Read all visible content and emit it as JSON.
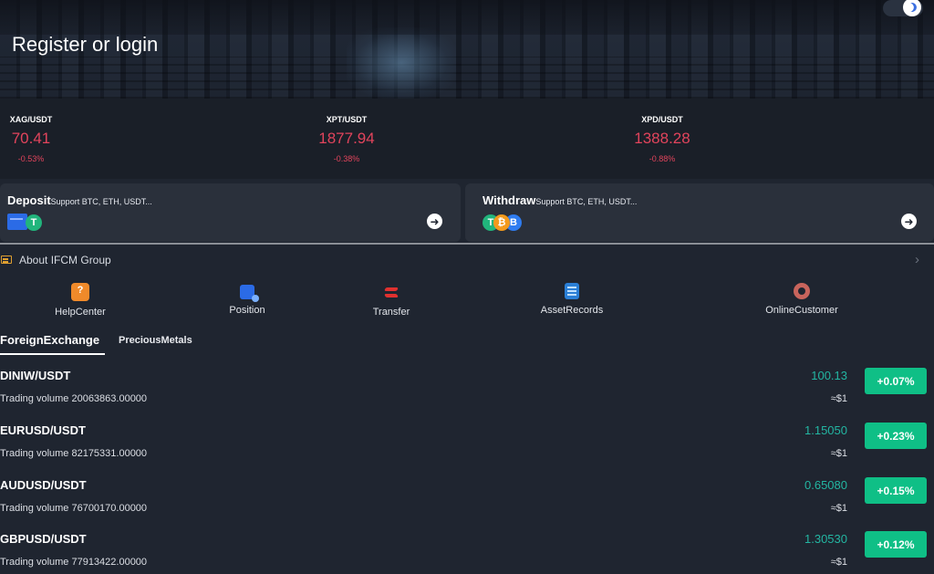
{
  "header": {
    "title": "Register or login",
    "theme_toggle_icon": "moon-icon"
  },
  "tickers": [
    {
      "symbol": "XAG/USDT",
      "price": "70.41",
      "change": "-0.53%"
    },
    {
      "symbol": "XPT/USDT",
      "price": "1877.94",
      "change": "-0.38%"
    },
    {
      "symbol": "XPD/USDT",
      "price": "1388.28",
      "change": "-0.88%"
    }
  ],
  "deposit": {
    "title": "Deposit",
    "subtitle": "Support BTC, ETH, USDT...",
    "arrow": "➜"
  },
  "withdraw": {
    "title": "Withdraw",
    "subtitle": "Support BTC, ETH, USDT...",
    "arrow": "➜"
  },
  "coins": {
    "tether": "T",
    "bitcoin": "₿",
    "ether": "B"
  },
  "about": {
    "label": "About IFCM Group",
    "chevron": "›"
  },
  "menu": [
    {
      "label": "HelpCenter",
      "icon": "help-icon"
    },
    {
      "label": "Position",
      "icon": "position-icon"
    },
    {
      "label": "Transfer",
      "icon": "transfer-icon"
    },
    {
      "label": "AssetRecords",
      "icon": "asset-records-icon"
    },
    {
      "label": "OnlineCustomer",
      "icon": "customer-service-icon"
    }
  ],
  "tabs": {
    "active": "ForeignExchange",
    "inactive": "PreciousMetals"
  },
  "markets": [
    {
      "pair": "DINIW/USDT",
      "volume": "Trading volume 20063863.00000",
      "price": "100.13",
      "usd": "≈$1",
      "change": "+0.07%"
    },
    {
      "pair": "EURUSD/USDT",
      "volume": "Trading volume 82175331.00000",
      "price": "1.15050",
      "usd": "≈$1",
      "change": "+0.23%"
    },
    {
      "pair": "AUDUSD/USDT",
      "volume": "Trading volume 76700170.00000",
      "price": "0.65080",
      "usd": "≈$1",
      "change": "+0.15%"
    },
    {
      "pair": "GBPUSD/USDT",
      "volume": "Trading volume 77913422.00000",
      "price": "1.30530",
      "usd": "≈$1",
      "change": "+0.12%"
    }
  ],
  "colors": {
    "background": "#1f2530",
    "down": "#e2445c",
    "up_badge": "#0fbf86",
    "price_teal": "#23b6a2"
  }
}
